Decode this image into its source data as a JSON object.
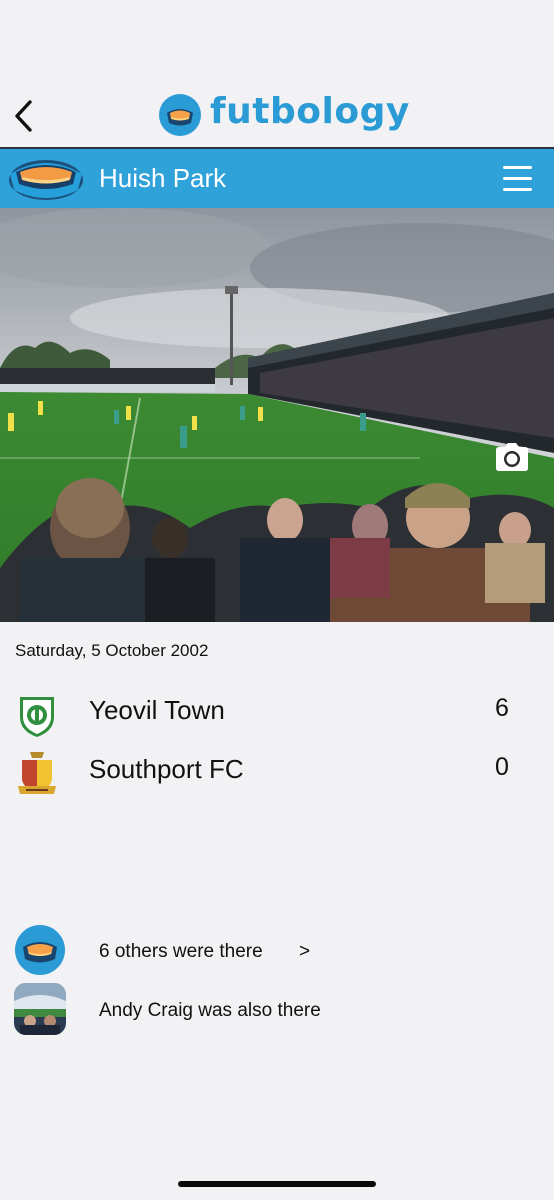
{
  "app": {
    "brand_name": "futbology",
    "accent_color": "#2fa2da",
    "brand_text_color": "#2b9bd6"
  },
  "nav": {
    "back_icon": "chevron-left-icon"
  },
  "venue": {
    "name": "Huish Park",
    "menu_icon": "hamburger-menu-icon"
  },
  "photo": {
    "camera_icon": "camera-icon"
  },
  "match": {
    "date": "Saturday, 5 October 2002",
    "teams": [
      {
        "name": "Yeovil Town",
        "score": "6",
        "crest_icon": "yeovil-town-crest-icon"
      },
      {
        "name": "Southport FC",
        "score": "0",
        "crest_icon": "southport-fc-crest-icon"
      }
    ]
  },
  "social": {
    "others_text": "6 others were there",
    "others_chevron": ">",
    "friend_text": "Andy Craig was also there"
  }
}
